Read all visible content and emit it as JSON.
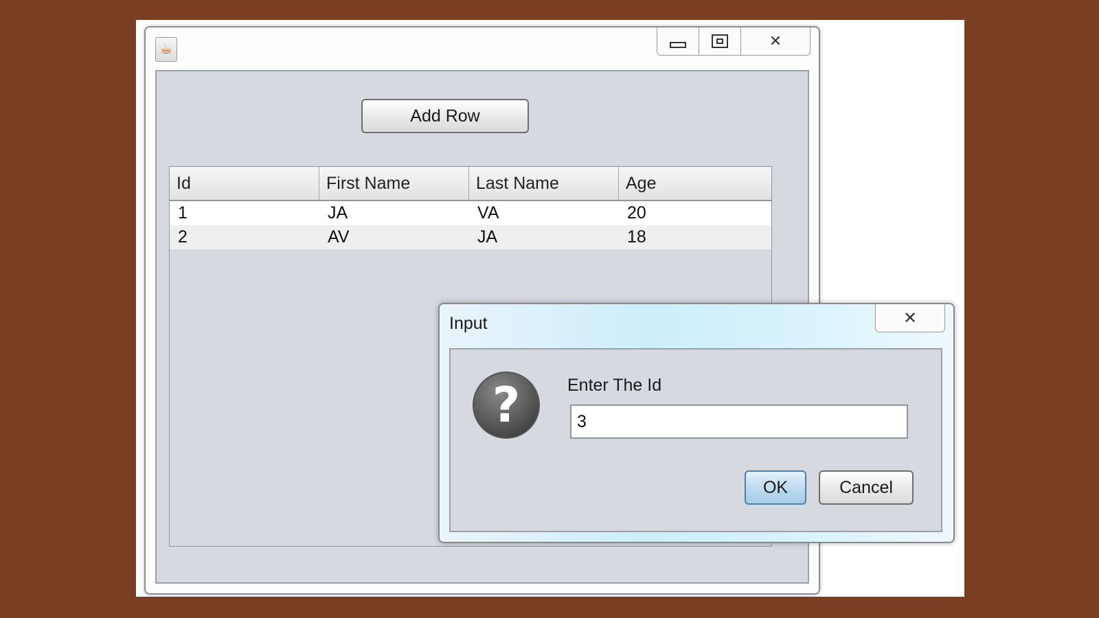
{
  "main_window": {
    "icons": {
      "app": "java-cup-icon",
      "minimize": "minimize-icon",
      "maximize": "maximize-icon",
      "close": "close-icon"
    },
    "close_glyph": "✕",
    "add_row_label": "Add Row",
    "table": {
      "columns": [
        "Id",
        "First Name",
        "Last Name",
        "Age"
      ],
      "rows": [
        [
          "1",
          "JA",
          "VA",
          "20"
        ],
        [
          "2",
          "AV",
          "JA",
          "18"
        ]
      ]
    }
  },
  "dialog": {
    "title": "Input",
    "close_glyph": "✕",
    "question_glyph": "?",
    "prompt": "Enter The Id",
    "input_value": "3",
    "ok_label": "OK",
    "cancel_label": "Cancel"
  },
  "colors": {
    "outer_background": "#7a3f22",
    "pane": "#d6d9e0",
    "ok_accent": "#4f7fa8"
  }
}
